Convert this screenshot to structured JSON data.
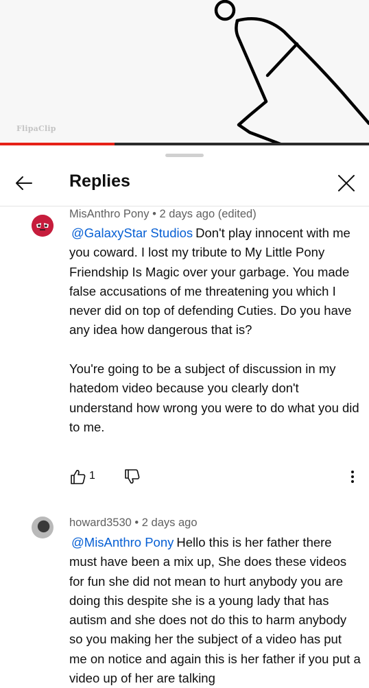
{
  "video": {
    "watermark": "FlipaClip",
    "progress_fraction": 0.31,
    "progress_color": "#e62117"
  },
  "header": {
    "title": "Replies",
    "back_icon": "arrow-left-icon",
    "close_icon": "close-icon"
  },
  "comments": [
    {
      "author": "MisAnthro Pony",
      "time": "2 days ago (edited)",
      "mention": "@GalaxyStar Studios",
      "paragraphs": [
        "Don't play innocent with me you coward. I lost my tribute to My Little Pony Friendship Is Magic over your garbage. You made false accusations of me threatening you which I never did on top of defending Cuties. Do you have any idea how dangerous that is?",
        "You're going to be a subject of discussion in my hatedom video because you clearly don't understand how wrong you were to do what you did to me."
      ],
      "likes": "1"
    },
    {
      "author": "howard3530",
      "time": "2 days ago",
      "mention": "@MisAnthro Pony",
      "paragraphs": [
        "Hello this is her father there must have been a mix up, She does these videos for fun she did not mean to hurt anybody you are doing this despite she is a young lady that has autism and she does not do this to harm anybody so you making her the subject of a video has put me on notice and again this is her father if you put a video up of her are talking"
      ]
    }
  ],
  "colors": {
    "mention": "#065fd4",
    "meta": "#606060",
    "text": "#0f0f0f"
  }
}
